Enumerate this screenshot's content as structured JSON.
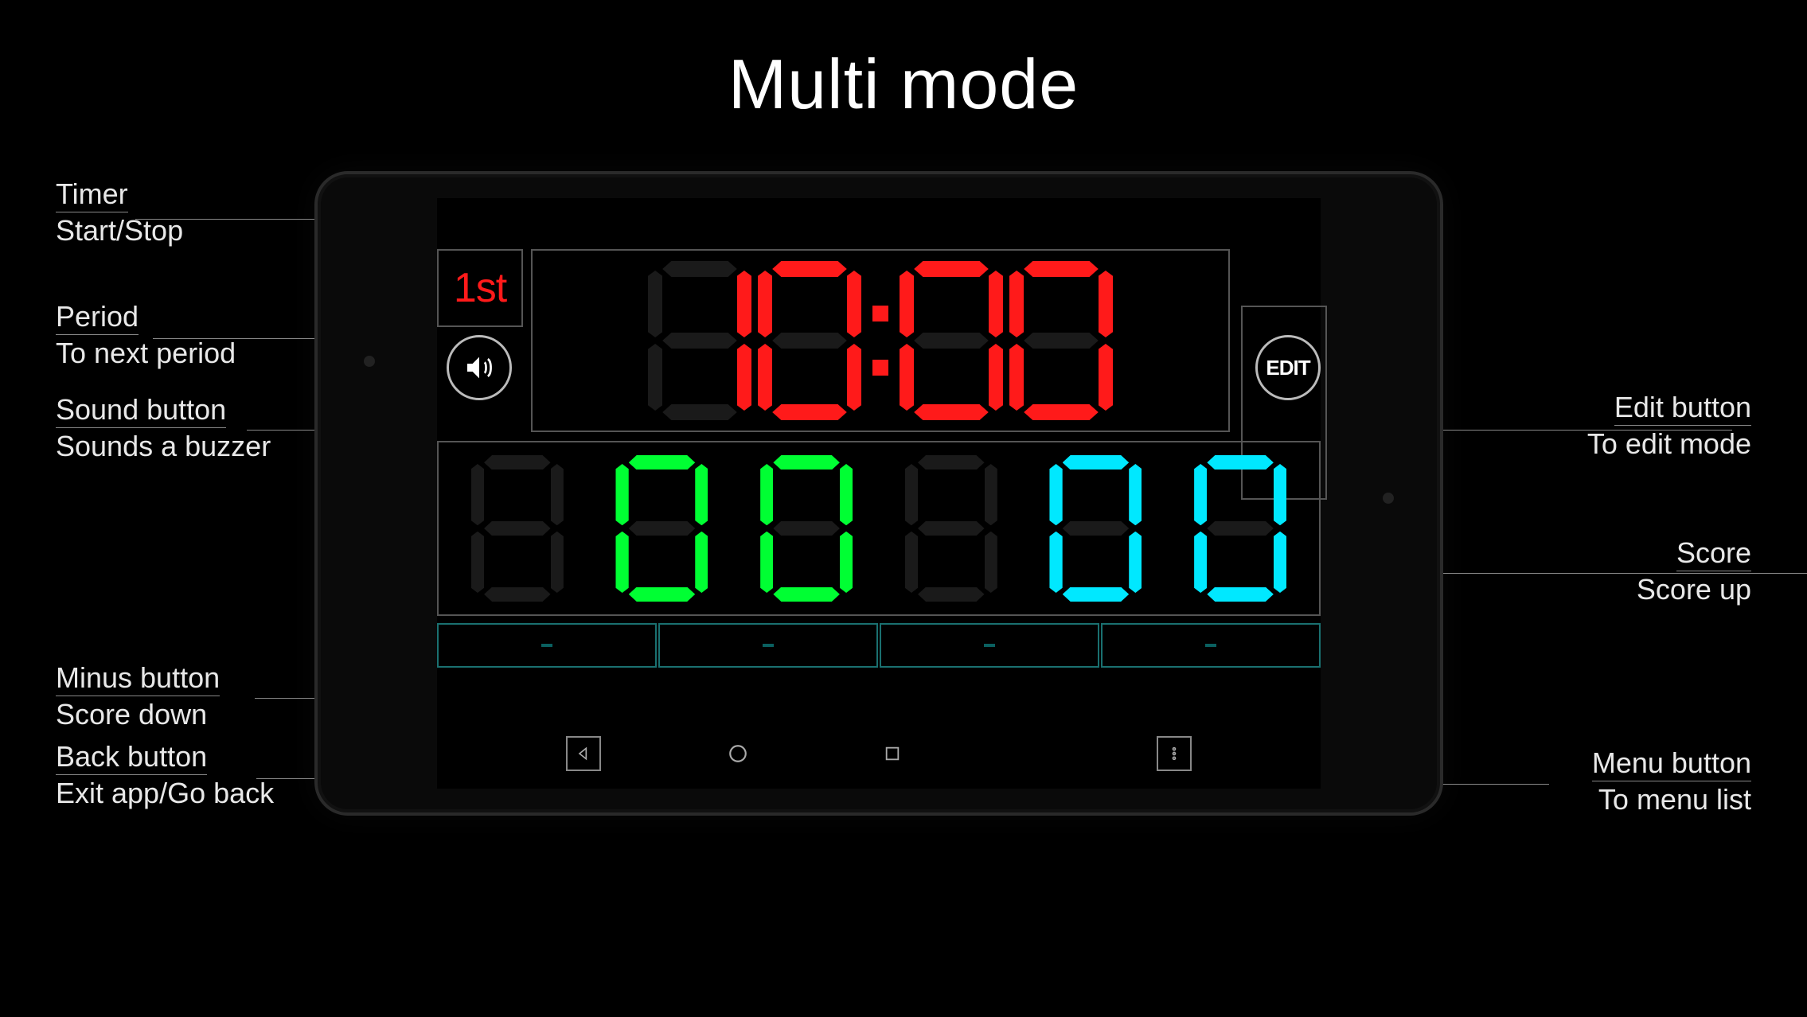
{
  "title": "Multi mode",
  "period": "1st",
  "edit_label": "EDIT",
  "timer": "10:00",
  "scores": {
    "team_a": "00",
    "team_b": "00"
  },
  "colors": {
    "timer": "#ff1a1a",
    "score_a": "#00ff33",
    "score_b": "#00e8ff",
    "period": "#ff1a1a"
  },
  "annotations": {
    "timer": {
      "title": "Timer",
      "sub": "Start/Stop"
    },
    "period": {
      "title": "Period",
      "sub": "To next period"
    },
    "sound": {
      "title": "Sound button",
      "sub": "Sounds a buzzer"
    },
    "minus": {
      "title": "Minus button",
      "sub": "Score down"
    },
    "back": {
      "title": "Back button",
      "sub": "Exit app/Go back"
    },
    "edit": {
      "title": "Edit button",
      "sub": "To edit mode"
    },
    "score": {
      "title": "Score",
      "sub": "Score up"
    },
    "menu": {
      "title": "Menu button",
      "sub": "To menu list"
    }
  }
}
